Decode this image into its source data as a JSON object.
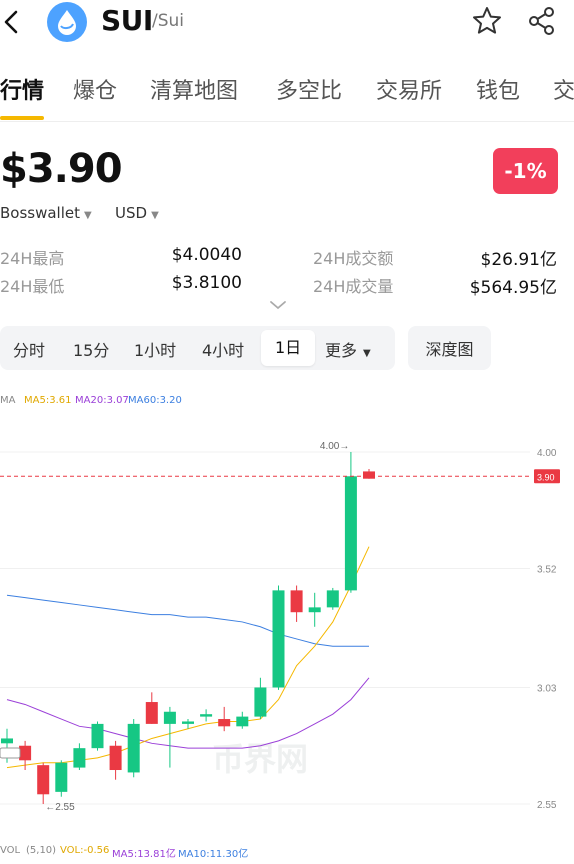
{
  "header": {
    "ticker": "SUI",
    "subtitle": "/Sui",
    "icons": [
      "back-arrow-icon",
      "sui-logo-icon",
      "star-icon",
      "share-icon"
    ]
  },
  "tabs": [
    "行情",
    "爆仓",
    "清算地图",
    "多空比",
    "交易所",
    "钱包",
    "交"
  ],
  "summary": {
    "price": "$3.90",
    "change": "-1%",
    "source": "Bosswallet",
    "currency": "USD"
  },
  "stats": {
    "high_label": "24H最高",
    "high_value": "$4.0040",
    "low_label": "24H最低",
    "low_value": "$3.8100",
    "turnover_label": "24H成交额",
    "turnover_value": "$26.91亿",
    "volume_label": "24H成交量",
    "volume_value": "$564.95亿"
  },
  "periods": {
    "items": [
      "分时",
      "15分",
      "1小时",
      "4小时",
      "1日",
      "更多"
    ],
    "active": "1日",
    "depth": "深度图"
  },
  "legend": {
    "ma": "MA",
    "ma5": "MA5:3.61",
    "ma20": "MA20:3.07",
    "ma60": "MA60:3.20",
    "vol": "VOL",
    "vol_params": "(5,10)",
    "vol_value": "VOL:-0.56",
    "vol_ma5": "MA5:13.81亿",
    "vol_ma10": "MA10:11.30亿"
  },
  "chart_data": {
    "type": "candlestick",
    "y_ticks": [
      "4.00",
      "3.52",
      "3.03",
      "2.55"
    ],
    "y_tick_values": [
      4.0,
      3.52,
      3.03,
      2.55
    ],
    "current_price": 3.9,
    "current_price_label": "3.90",
    "high_marker": "4.00",
    "low_marker": "2.55",
    "candles": [
      {
        "o": 2.8,
        "h": 2.86,
        "l": 2.72,
        "c": 2.82
      },
      {
        "o": 2.79,
        "h": 2.81,
        "l": 2.69,
        "c": 2.73
      },
      {
        "o": 2.71,
        "h": 2.72,
        "l": 2.55,
        "c": 2.59
      },
      {
        "o": 2.6,
        "h": 2.73,
        "l": 2.58,
        "c": 2.72
      },
      {
        "o": 2.7,
        "h": 2.8,
        "l": 2.69,
        "c": 2.78
      },
      {
        "o": 2.78,
        "h": 2.89,
        "l": 2.77,
        "c": 2.88
      },
      {
        "o": 2.79,
        "h": 2.81,
        "l": 2.65,
        "c": 2.69
      },
      {
        "o": 2.68,
        "h": 2.9,
        "l": 2.66,
        "c": 2.88
      },
      {
        "o": 2.97,
        "h": 3.01,
        "l": 2.88,
        "c": 2.88
      },
      {
        "o": 2.88,
        "h": 2.95,
        "l": 2.7,
        "c": 2.93
      },
      {
        "o": 2.88,
        "h": 2.9,
        "l": 2.86,
        "c": 2.89
      },
      {
        "o": 2.91,
        "h": 2.94,
        "l": 2.89,
        "c": 2.92
      },
      {
        "o": 2.9,
        "h": 2.95,
        "l": 2.85,
        "c": 2.87
      },
      {
        "o": 2.87,
        "h": 2.93,
        "l": 2.86,
        "c": 2.91
      },
      {
        "o": 2.91,
        "h": 3.07,
        "l": 2.9,
        "c": 3.03
      },
      {
        "o": 3.03,
        "h": 3.45,
        "l": 3.02,
        "c": 3.43
      },
      {
        "o": 3.43,
        "h": 3.45,
        "l": 3.3,
        "c": 3.34
      },
      {
        "o": 3.34,
        "h": 3.42,
        "l": 3.28,
        "c": 3.36
      },
      {
        "o": 3.36,
        "h": 3.44,
        "l": 3.35,
        "c": 3.43
      },
      {
        "o": 3.43,
        "h": 4.0,
        "l": 3.42,
        "c": 3.9
      },
      {
        "o": 3.92,
        "h": 3.93,
        "l": 3.89,
        "c": 3.89
      }
    ],
    "ma5": [
      2.7,
      2.71,
      2.72,
      2.72,
      2.73,
      2.74,
      2.76,
      2.79,
      2.82,
      2.84,
      2.86,
      2.88,
      2.89,
      2.89,
      2.9,
      2.98,
      3.12,
      3.2,
      3.3,
      3.45,
      3.61
    ],
    "ma20": [
      2.98,
      2.96,
      2.93,
      2.9,
      2.87,
      2.86,
      2.84,
      2.82,
      2.8,
      2.79,
      2.78,
      2.78,
      2.78,
      2.78,
      2.79,
      2.81,
      2.84,
      2.88,
      2.92,
      2.98,
      3.07
    ],
    "ma60": [
      3.41,
      3.4,
      3.39,
      3.38,
      3.37,
      3.36,
      3.35,
      3.34,
      3.33,
      3.33,
      3.32,
      3.32,
      3.31,
      3.3,
      3.28,
      3.25,
      3.23,
      3.21,
      3.2,
      3.2,
      3.2
    ],
    "colors": {
      "up": "#16C784",
      "down": "#EA3943",
      "ma5": "#F5B800",
      "ma20": "#9B40D8",
      "ma60": "#3C7FE0",
      "price_line": "#EA3943"
    }
  },
  "watermark": "币界网"
}
